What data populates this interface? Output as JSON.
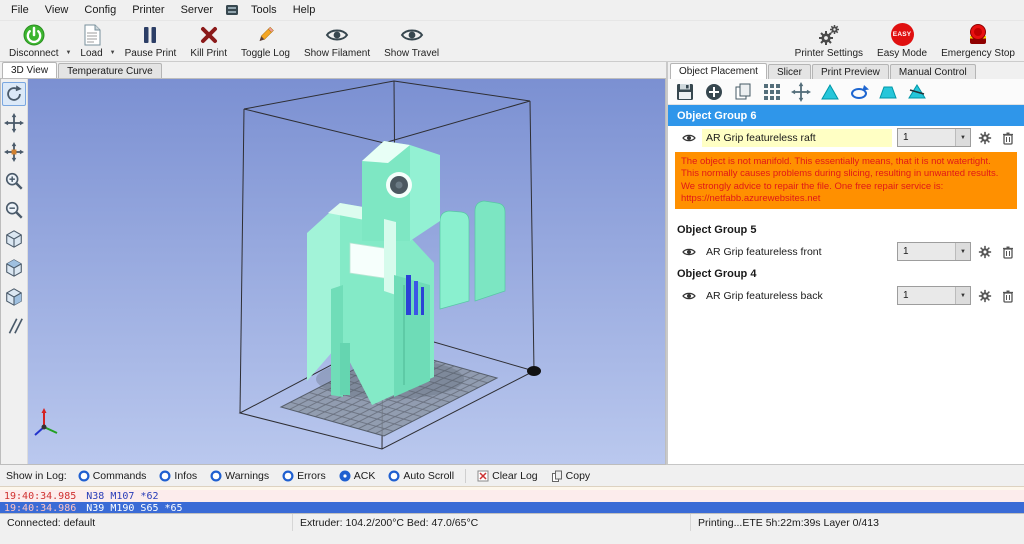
{
  "colors": {
    "accent_blue": "#2f96ea",
    "selection_yellow": "#ffffc4",
    "warning_orange": "#ff9000",
    "warning_text_red": "#e01818",
    "model_mint": "#84eac7",
    "viewport_gradient_top": "#7b90d2",
    "viewport_gradient_bottom": "#bac8ee",
    "easy_mode_red": "#e01010",
    "log_selected_blue": "#3a6bd6"
  },
  "menubar": {
    "items": [
      "File",
      "View",
      "Config",
      "Printer",
      "Server",
      "Tools",
      "Help"
    ]
  },
  "toolbar": {
    "buttons": [
      {
        "label": "Disconnect"
      },
      {
        "label": "Load"
      },
      {
        "label": "Pause Print"
      },
      {
        "label": "Kill Print"
      },
      {
        "label": "Toggle Log"
      },
      {
        "label": "Show Filament"
      },
      {
        "label": "Show Travel"
      }
    ],
    "right_buttons": [
      {
        "label": "Printer Settings"
      },
      {
        "label": "Easy Mode",
        "badge": "EASY"
      },
      {
        "label": "Emergency Stop"
      }
    ]
  },
  "left_tabs": [
    {
      "label": "3D View"
    },
    {
      "label": "Temperature Curve"
    }
  ],
  "right_tabs": [
    {
      "label": "Object Placement"
    },
    {
      "label": "Slicer"
    },
    {
      "label": "Print Preview"
    },
    {
      "label": "Manual Control"
    }
  ],
  "object_panel": {
    "groups": [
      {
        "title": "Object Group 6",
        "items": [
          {
            "name": "AR Grip featureless raft",
            "copies": "1"
          }
        ],
        "warning": "The object is not manifold. This essentially means, that it is not watertight. This normally causes problems during slicing, resulting in unwanted results. We strongly advice to repair the file. One free repair service is: https://netfabb.azurewebsites.net"
      },
      {
        "title": "Object Group 5",
        "items": [
          {
            "name": "AR Grip featureless front",
            "copies": "1"
          }
        ]
      },
      {
        "title": "Object Group 4",
        "items": [
          {
            "name": "AR Grip featureless back",
            "copies": "1"
          }
        ]
      }
    ]
  },
  "log_controls": {
    "label": "Show in Log:",
    "toggles": [
      {
        "label": "Commands"
      },
      {
        "label": "Infos"
      },
      {
        "label": "Warnings"
      },
      {
        "label": "Errors"
      },
      {
        "label": "ACK"
      },
      {
        "label": "Auto Scroll"
      }
    ],
    "clear_label": "Clear Log",
    "copy_label": "Copy"
  },
  "log": {
    "lines": [
      {
        "time": "19:40:34.985",
        "text": "N38 M107 *62"
      },
      {
        "time": "19:40:34.986",
        "text": "N39 M190 S65 *65"
      }
    ]
  },
  "statusbar": {
    "connection": "Connected: default",
    "temperatures": "Extruder: 104.2/200°C Bed: 47.0/65°C",
    "progress": "Printing...ETE 5h:22m:39s Layer 0/413"
  }
}
